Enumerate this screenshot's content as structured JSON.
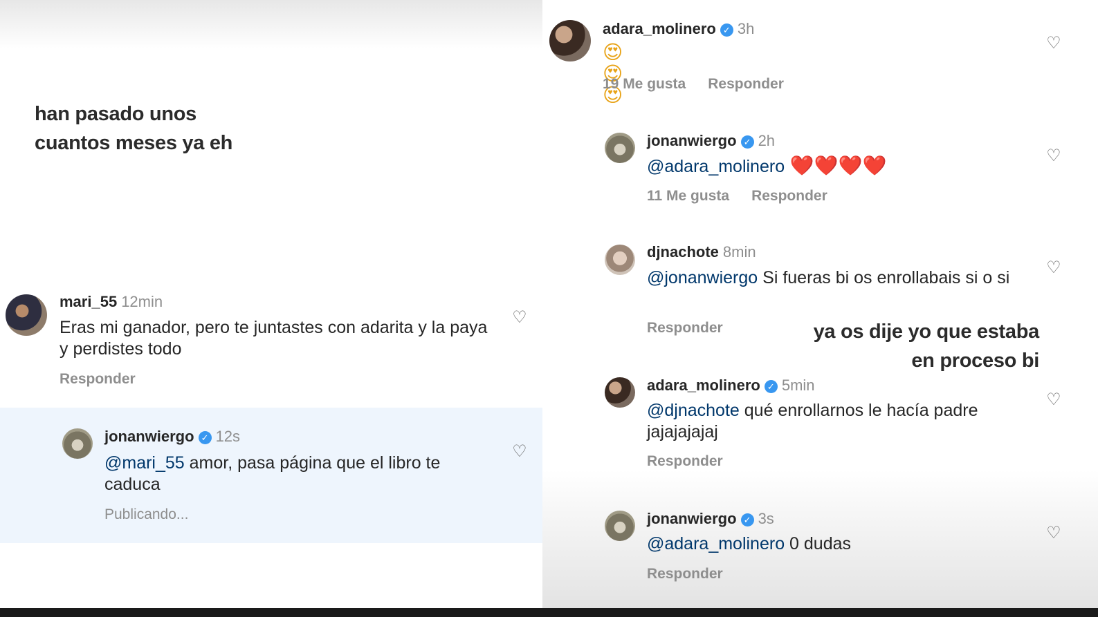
{
  "left": {
    "overlay_lines": [
      "han pasado unos",
      "cuantos meses ya eh"
    ],
    "comments": [
      {
        "username": "mari_55",
        "time": "12min",
        "verified": false,
        "mention": "",
        "text": "Eras mi ganador, pero te juntastes con adarita y la paya y perdistes todo",
        "likes": "",
        "reply": "Responder"
      },
      {
        "username": "jonanwiergo",
        "time": "12s",
        "verified": true,
        "mention": "@mari_55",
        "text": " amor, pasa página que el libro te caduca",
        "likes": "",
        "reply": "Publicando..."
      }
    ]
  },
  "right": {
    "overlay_lines": [
      "ya os dije yo que estaba",
      "en proceso bi"
    ],
    "comments": [
      {
        "username": "adara_molinero",
        "time": "3h",
        "verified": true,
        "mention": "",
        "text": "😍😍😍",
        "likes": "19 Me gusta",
        "reply": "Responder"
      },
      {
        "username": "jonanwiergo",
        "time": "2h",
        "verified": true,
        "mention": "@adara_molinero",
        "text": " ❤️❤️❤️❤️",
        "likes": "11 Me gusta",
        "reply": "Responder"
      },
      {
        "username": "djnachote",
        "time": "8min",
        "verified": false,
        "mention": "@jonanwiergo",
        "text": " Si fueras bi os enrollabais si o si",
        "likes": "",
        "reply": "Responder"
      },
      {
        "username": "adara_molinero",
        "time": "5min",
        "verified": true,
        "mention": "@djnachote",
        "text": " qué enrollarnos le hacía padre jajajajajaj",
        "likes": "",
        "reply": "Responder"
      },
      {
        "username": "jonanwiergo",
        "time": "3s",
        "verified": true,
        "mention": "@adara_molinero",
        "text": " 0 dudas",
        "likes": "",
        "reply": "Responder"
      }
    ]
  },
  "icons": {
    "heart": "heart-icon",
    "verified": "verified-badge-icon"
  },
  "colors": {
    "mention": "#00376b",
    "verified": "#3897f0",
    "muted": "#8e8e8e",
    "highlight": "#eef5fd"
  }
}
